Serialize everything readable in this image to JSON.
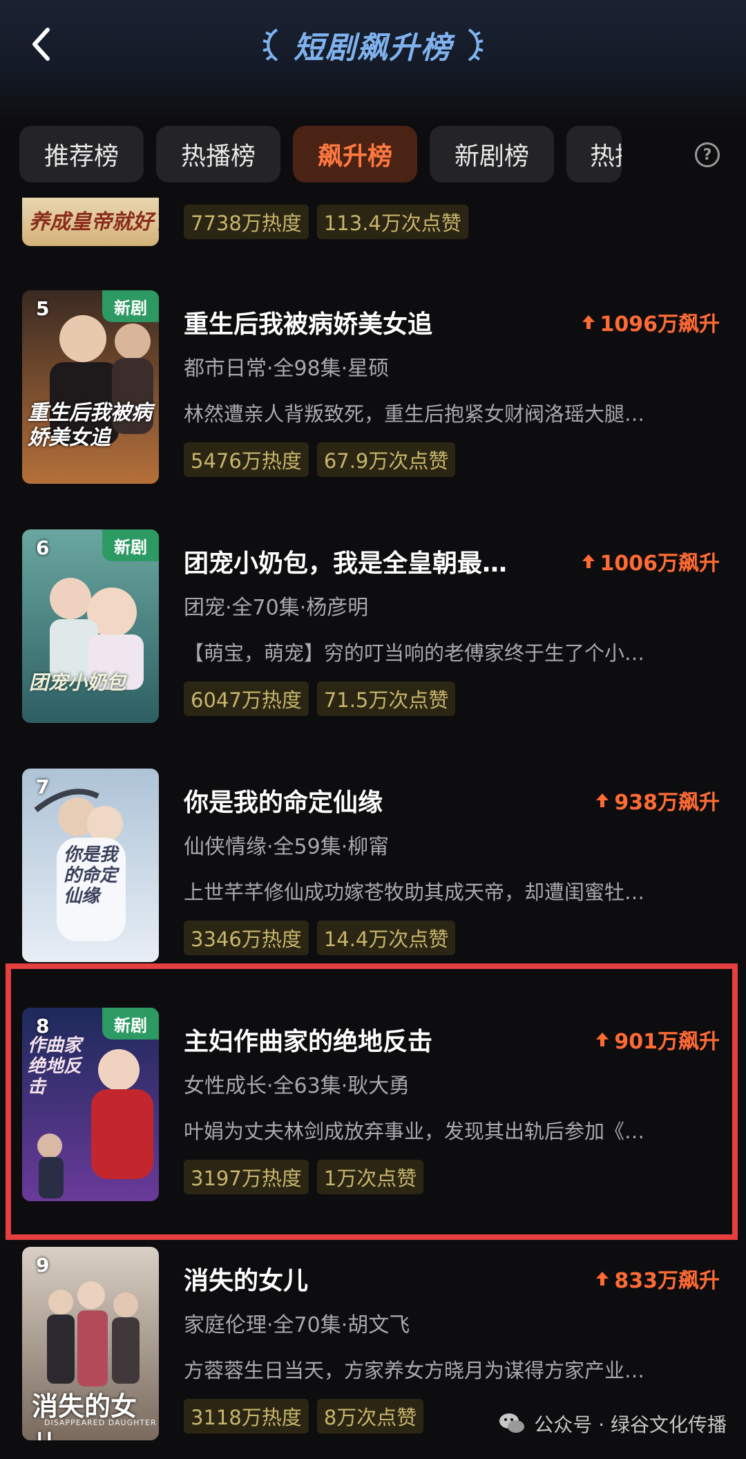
{
  "header": {
    "title": "短剧飙升榜"
  },
  "tabs": [
    {
      "label": "推荐榜",
      "active": false
    },
    {
      "label": "热播榜",
      "active": false
    },
    {
      "label": "飙升榜",
      "active": true
    },
    {
      "label": "新剧榜",
      "active": false
    },
    {
      "label": "热播",
      "active": false
    }
  ],
  "help_label": "?",
  "items": [
    {
      "poster_text": "养成皇帝就好了",
      "heat": "7738万热度",
      "likes": "113.4万次点赞"
    },
    {
      "rank": "5",
      "badge": "新剧",
      "title": "重生后我被病娇美女追",
      "rise": "1096万飙升",
      "meta": "都市日常·全98集·星硕",
      "desc": "林然遭亲人背叛致死，重生后抱紧女财阀洛瑶大腿…",
      "heat": "5476万热度",
      "likes": "67.9万次点赞",
      "poster_text": "重生后我被病娇美女追"
    },
    {
      "rank": "6",
      "badge": "新剧",
      "title": "团宠小奶包，我是全皇朝最…",
      "rise": "1006万飙升",
      "meta": "团宠·全70集·杨彦明",
      "desc": "【萌宝，萌宠】穷的叮当响的老傅家终于生了个小…",
      "heat": "6047万热度",
      "likes": "71.5万次点赞",
      "poster_text": "团宠小奶包"
    },
    {
      "rank": "7",
      "title": "你是我的命定仙缘",
      "rise": "938万飙升",
      "meta": "仙侠情缘·全59集·柳甯",
      "desc": "上世芊芊修仙成功嫁苍牧助其成天帝，却遭闺蜜牡…",
      "heat": "3346万热度",
      "likes": "14.4万次点赞",
      "poster_text": "你是我的命定仙缘"
    },
    {
      "rank": "8",
      "badge": "新剧",
      "title": "主妇作曲家的绝地反击",
      "rise": "901万飙升",
      "meta": "女性成长·全63集·耿大勇",
      "desc": "叶娟为丈夫林剑成放弃事业，发现其出轨后参加《…",
      "heat": "3197万热度",
      "likes": "1万次点赞",
      "poster_text": "作曲家绝地反击"
    },
    {
      "rank": "9",
      "title": "消失的女儿",
      "rise": "833万飙升",
      "meta": "家庭伦理·全70集·胡文飞",
      "desc": "方蓉蓉生日当天，方家养女方晓月为谋得方家产业…",
      "heat": "3118万热度",
      "likes": "8万次点赞",
      "poster_text": "消失的女儿",
      "poster_subtext": "DISAPPEARED DAUGHTER"
    }
  ],
  "watermark": "公众号 · 绿谷文化传播",
  "colors": {
    "accent": "#ff6b35",
    "badge_green": "#2d9a63",
    "highlight_red": "#e53f3f",
    "chip_text": "#c9b56b"
  }
}
